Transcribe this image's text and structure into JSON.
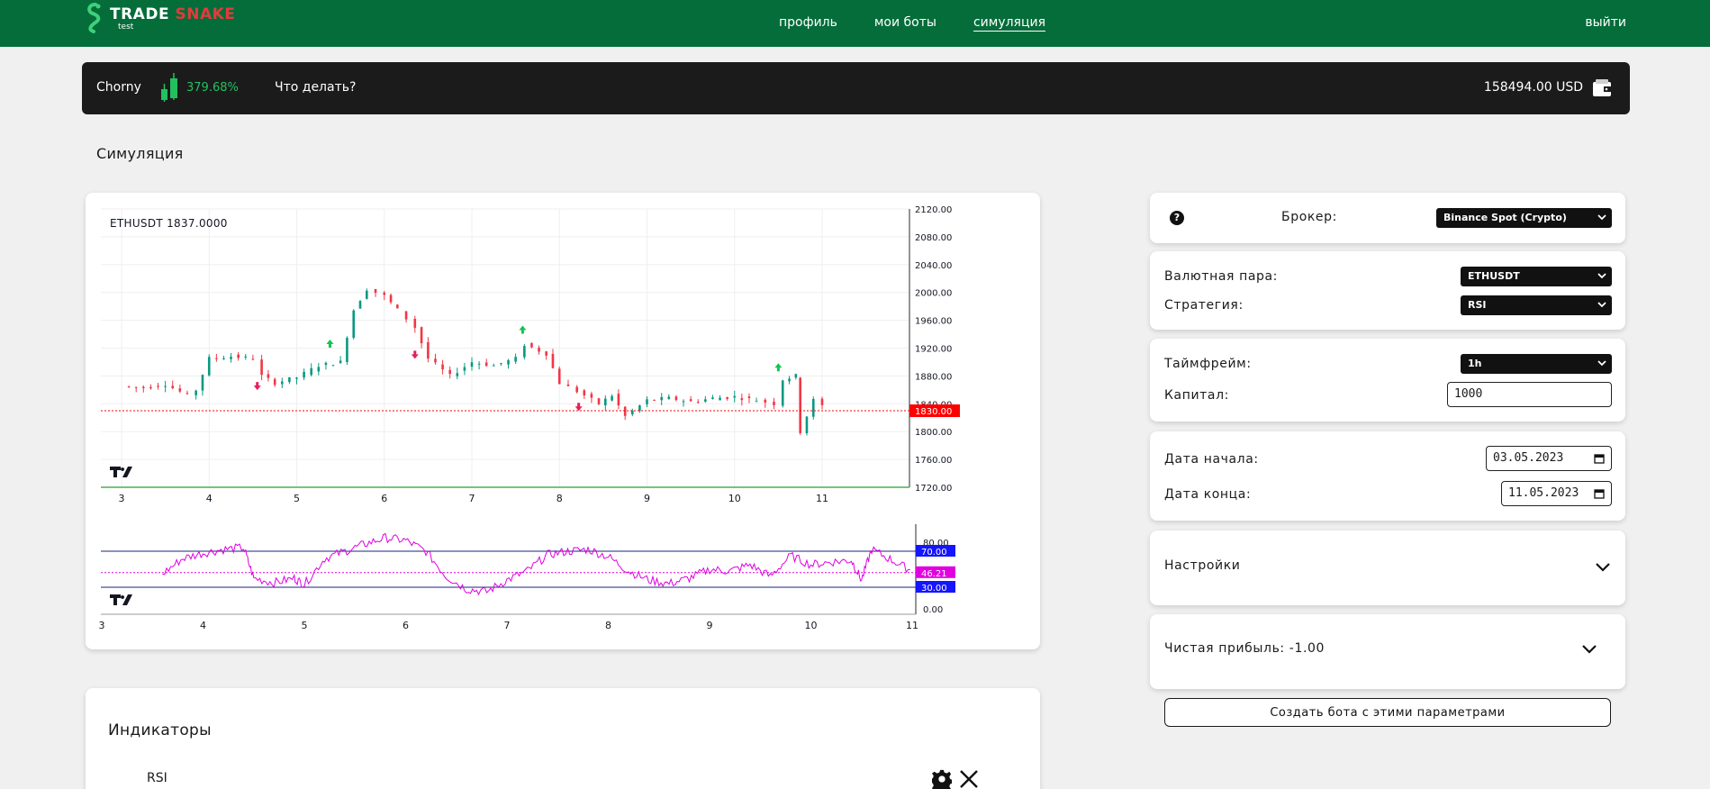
{
  "nav": {
    "logo_main": "TRADE",
    "logo_accent": "SNAKE",
    "logo_sub": "test",
    "links": [
      "профиль",
      "мои боты",
      "симуляция"
    ],
    "active_index": 2,
    "logout": "выйти"
  },
  "info": {
    "user": "Chorny",
    "percent": "379.68%",
    "todo": "Что делать?",
    "balance": "158494.00 USD"
  },
  "page_title": "Симуляция",
  "chart": {
    "symbol": "ETHUSDT",
    "price": "1837.0000",
    "symbol_label": "ETHUSDT 1837.0000",
    "last_label": "1830.00",
    "price_ticks": [
      "2120.00",
      "2080.00",
      "2040.00",
      "2000.00",
      "1960.00",
      "1920.00",
      "1880.00",
      "1840.00",
      "1800.00",
      "1760.00",
      "1720.00"
    ],
    "x_ticks": [
      "3",
      "4",
      "5",
      "6",
      "7",
      "8",
      "9",
      "10",
      "11"
    ],
    "rsi_ticks": [
      "80.00",
      "0.00"
    ],
    "rsi_levels": [
      "70.00",
      "46.21",
      "30.00"
    ]
  },
  "chart_data": {
    "type": "line",
    "title": "ETHUSDT 1837.0000",
    "xlabel": "",
    "ylabel": "",
    "ylim": [
      1720,
      2120
    ],
    "x_ticks": [
      3,
      4,
      5,
      6,
      7,
      8,
      9,
      10,
      11
    ],
    "series": [
      {
        "x": [
          3.0,
          3.25,
          3.5,
          3.75,
          3.85,
          4.0,
          4.25,
          4.5,
          4.6,
          4.75,
          5.0,
          5.25,
          5.5,
          5.65,
          5.8,
          6.0,
          6.15,
          6.35,
          6.5,
          6.75,
          7.0,
          7.25,
          7.5,
          7.6,
          7.85,
          8.0,
          8.2,
          8.45,
          8.6,
          8.75,
          9.0,
          9.25,
          9.5,
          9.75,
          10.0,
          10.25,
          10.45,
          10.55,
          10.7,
          10.75,
          10.9,
          11.0
        ],
        "values": [
          1865,
          1863,
          1868,
          1852,
          1860,
          1905,
          1908,
          1905,
          1880,
          1870,
          1878,
          1895,
          1900,
          1975,
          2005,
          1995,
          1975,
          1950,
          1905,
          1880,
          1900,
          1895,
          1905,
          1925,
          1912,
          1870,
          1858,
          1840,
          1852,
          1822,
          1845,
          1848,
          1843,
          1848,
          1850,
          1845,
          1840,
          1875,
          1880,
          1800,
          1845,
          1837
        ]
      }
    ],
    "markers": [
      {
        "type": "sell",
        "x": 4.55,
        "y": 1870
      },
      {
        "type": "buy",
        "x": 5.38,
        "y": 1922
      },
      {
        "type": "sell",
        "x": 6.35,
        "y": 1915
      },
      {
        "type": "buy",
        "x": 7.58,
        "y": 1942
      },
      {
        "type": "sell",
        "x": 8.22,
        "y": 1840
      },
      {
        "type": "buy",
        "x": 10.5,
        "y": 1888
      }
    ],
    "last_value": 1830,
    "rsi": {
      "ylim": [
        0,
        100
      ],
      "levels": [
        70,
        30
      ],
      "last_value": 46.21,
      "x": [
        3.6,
        3.8,
        4.0,
        4.2,
        4.4,
        4.5,
        4.7,
        4.9,
        5.0,
        5.2,
        5.4,
        5.6,
        5.8,
        6.0,
        6.2,
        6.4,
        6.6,
        6.8,
        7.0,
        7.2,
        7.4,
        7.6,
        7.8,
        8.0,
        8.2,
        8.4,
        8.6,
        8.8,
        9.0,
        9.2,
        9.4,
        9.6,
        9.8,
        10.0,
        10.2,
        10.4,
        10.5,
        10.6,
        10.8,
        11.0
      ],
      "values": [
        45,
        62,
        68,
        72,
        74,
        40,
        35,
        40,
        33,
        62,
        70,
        78,
        85,
        82,
        70,
        42,
        28,
        25,
        38,
        48,
        66,
        70,
        72,
        64,
        48,
        38,
        34,
        40,
        50,
        48,
        55,
        42,
        65,
        55,
        58,
        60,
        38,
        72,
        60,
        48
      ]
    }
  },
  "panel": {
    "broker_label": "Брокер:",
    "broker_value": "Binance Spot (Crypto)",
    "pair_label": "Валютная пара:",
    "pair_value": "ETHUSDT",
    "strategy_label": "Стратегия:",
    "strategy_value": "RSI",
    "timeframe_label": "Таймфрейм:",
    "timeframe_value": "1h",
    "capital_label": "Капитал:",
    "capital_value": "1000",
    "start_label": "Дата начала:",
    "start_value": "03.05.2023",
    "end_label": "Дата конца:",
    "end_value": "11.05.2023",
    "settings_label": "Настройки",
    "profit_label": "Чистая прибыль: -1.00",
    "create_button": "Создать бота с этими параметрами",
    "help": "?"
  },
  "indicators": {
    "title": "Индикаторы",
    "items": [
      "RSI"
    ]
  },
  "colors": {
    "nav_green": "#046d3a",
    "up": "#089981",
    "down": "#f23645",
    "rsi": "#e000e0",
    "last_price": "#ff0000"
  }
}
